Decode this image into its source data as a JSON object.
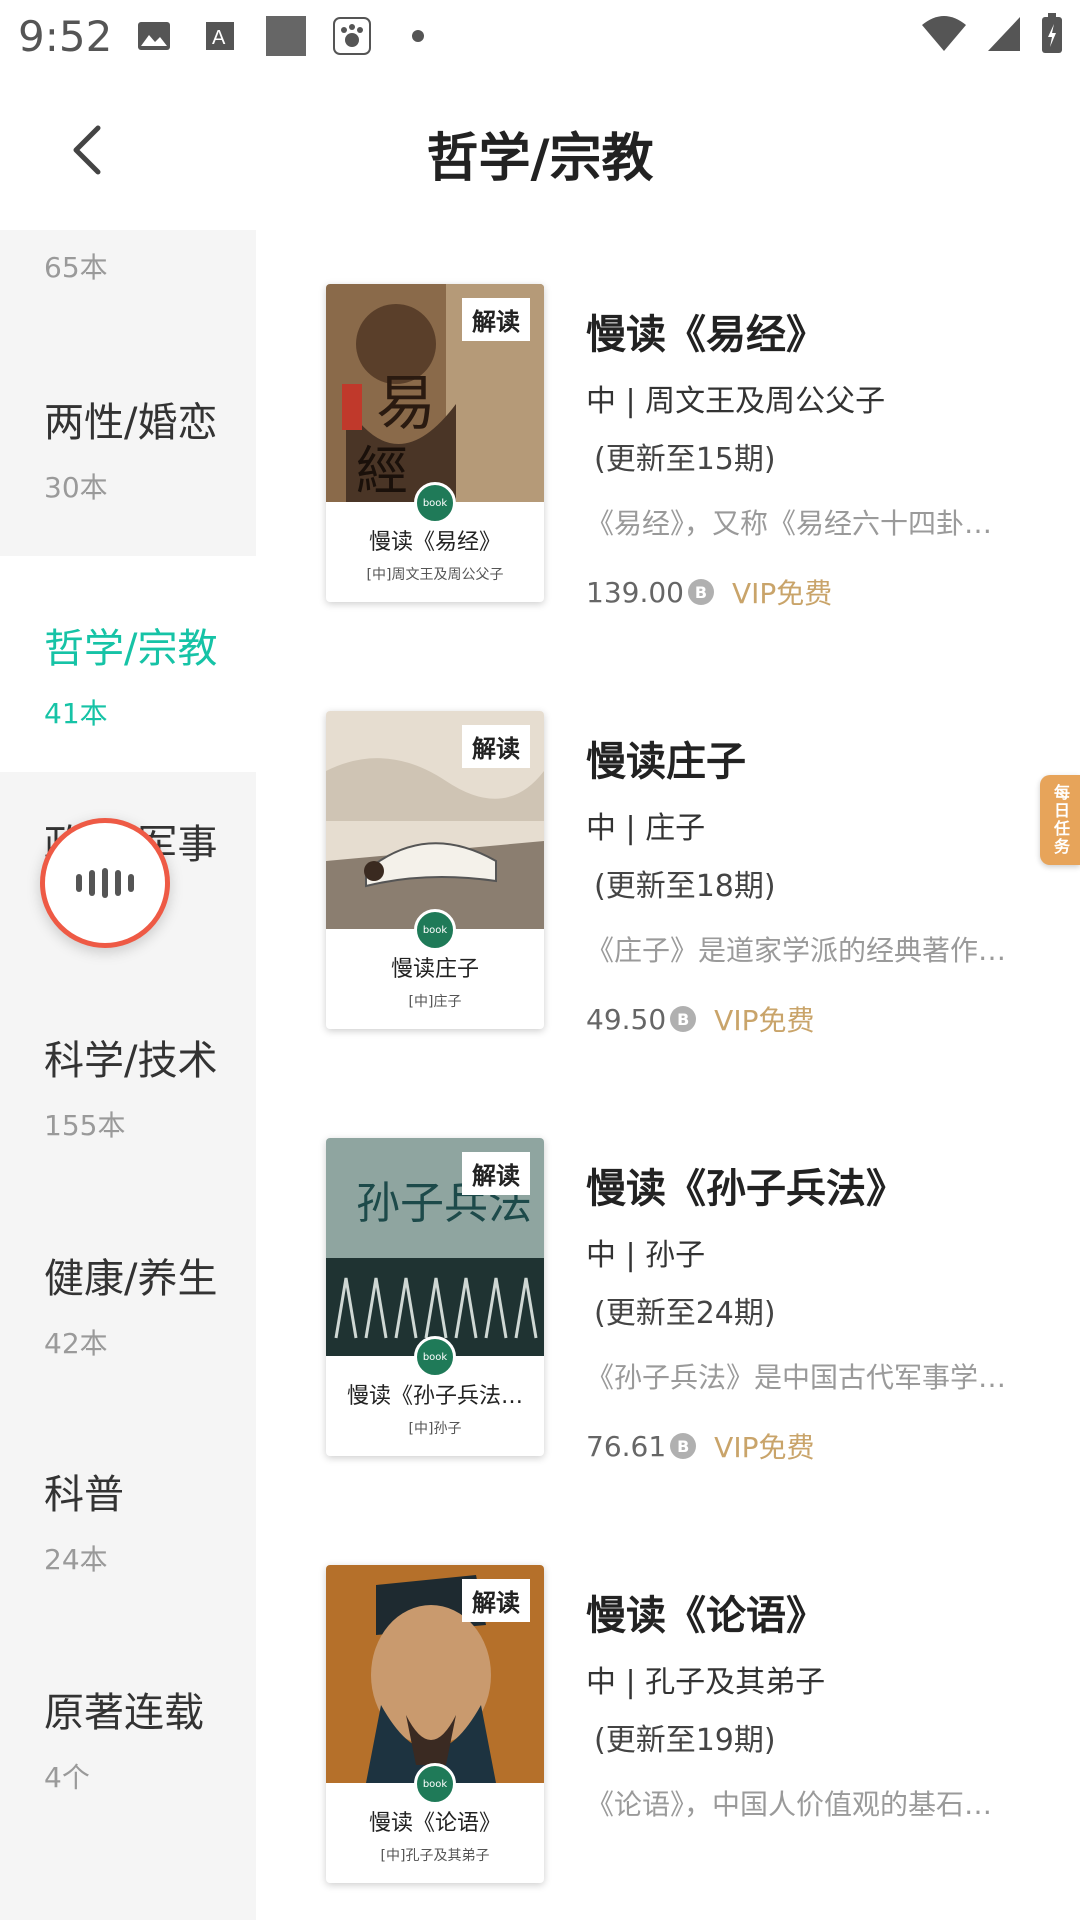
{
  "status_bar": {
    "time": "9:52"
  },
  "header": {
    "title": "哲学/宗教"
  },
  "sidebar": {
    "items": [
      {
        "name": "",
        "count": "65本",
        "active": false
      },
      {
        "name": "两性/婚恋",
        "count": "30本",
        "active": false
      },
      {
        "name": "哲学/宗教",
        "count": "41本",
        "active": true
      },
      {
        "name": "政治/军事",
        "count": "",
        "active": false
      },
      {
        "name": "科学/技术",
        "count": "155本",
        "active": false
      },
      {
        "name": "健康/养生",
        "count": "42本",
        "active": false
      },
      {
        "name": "科普",
        "count": "24本",
        "active": false
      },
      {
        "name": "原著连载",
        "count": "4个",
        "active": false
      }
    ]
  },
  "books": [
    {
      "tag": "解读",
      "cover_title": "慢读《易经》",
      "cover_author": "[中]周文王及周公父子",
      "title": "慢读《易经》",
      "author": "中 | 周文王及周公父子",
      "update": "(更新至15期)",
      "desc": "《易经》，又称《易经六十四卦…",
      "price": "139.00",
      "vip": "VIP免费"
    },
    {
      "tag": "解读",
      "cover_title": "慢读庄子",
      "cover_author": "[中]庄子",
      "title": "慢读庄子",
      "author": "中 | 庄子",
      "update": "(更新至18期)",
      "desc": "《庄子》是道家学派的经典著作…",
      "price": "49.50",
      "vip": "VIP免费"
    },
    {
      "tag": "解读",
      "cover_title": "慢读《孙子兵法…",
      "cover_author": "[中]孙子",
      "title": "慢读《孙子兵法》",
      "author": "中 | 孙子",
      "update": "(更新至24期)",
      "desc": "《孙子兵法》是中国古代军事学…",
      "price": "76.61",
      "vip": "VIP免费"
    },
    {
      "tag": "解读",
      "cover_title": "慢读《论语》",
      "cover_author": "[中]孔子及其弟子",
      "title": "慢读《论语》",
      "author": "中 | 孔子及其弟子",
      "update": "(更新至19期)",
      "desc": "《论语》，中国人价值观的基石…",
      "price": "",
      "vip": ""
    }
  ],
  "floating": {
    "daily_label": "每日任务"
  },
  "colors": {
    "accent": "#16c3a6",
    "vip": "#c9a46a",
    "voice_ring": "#ee5a45"
  }
}
